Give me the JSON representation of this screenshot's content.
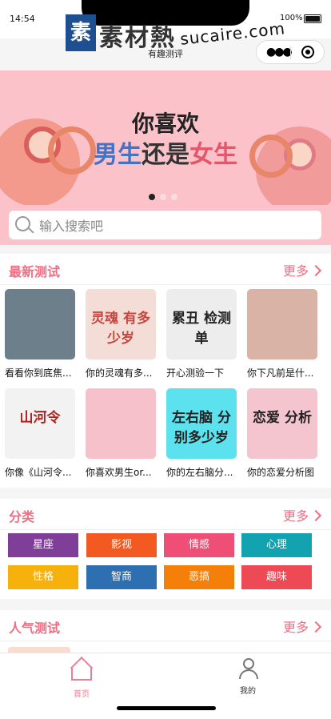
{
  "status": {
    "time": "14:54",
    "battery": "100%",
    "battery_level": 1.0
  },
  "watermark": {
    "cn": "素材熱",
    "mark": "素",
    "en": "sucaire.com"
  },
  "app": {
    "title": "有趣测评"
  },
  "banner": {
    "line1": "你喜欢",
    "line2_male": "男生",
    "line2_mid": "还是",
    "line2_female": "女生",
    "active_index": 0,
    "count": 3
  },
  "search": {
    "placeholder": "输入搜索吧"
  },
  "latest": {
    "title": "最新测试",
    "more": "更多",
    "items": [
      {
        "caption": "看看你到底焦...",
        "thumb_text": "",
        "thumb_color": "#6e7f8c"
      },
      {
        "caption": "你的灵魂有多...",
        "thumb_text": "灵魂 有多少岁",
        "thumb_color": "#f3ddd6"
      },
      {
        "caption": "开心测验一下",
        "thumb_text": "累丑 检测单",
        "thumb_color": "#ededed"
      },
      {
        "caption": "你下凡前是什...",
        "thumb_text": "",
        "thumb_color": "#d9b3a5"
      },
      {
        "caption": "你像《山河令...",
        "thumb_text": "山河令",
        "thumb_color": "#f2f2f2"
      },
      {
        "caption": "你喜欢男生or...",
        "thumb_text": "",
        "thumb_color": "#f6c1ca"
      },
      {
        "caption": "你的左右脑分...",
        "thumb_text": "左右脑 分别多少岁",
        "thumb_color": "#5ce2ee"
      },
      {
        "caption": "你的恋爱分析图",
        "thumb_text": "恋爱 分析",
        "thumb_color": "#f4c5ce"
      }
    ]
  },
  "category": {
    "title": "分类",
    "more": "更多",
    "items": [
      {
        "label": "星座",
        "color": "#7f3f98"
      },
      {
        "label": "影视",
        "color": "#f25a21"
      },
      {
        "label": "情感",
        "color": "#ef4f77"
      },
      {
        "label": "心理",
        "color": "#13a2b0"
      },
      {
        "label": "性格",
        "color": "#f7b10d"
      },
      {
        "label": "智商",
        "color": "#2d6fb0"
      },
      {
        "label": "恶搞",
        "color": "#f4800a"
      },
      {
        "label": "趣味",
        "color": "#ee4a56"
      }
    ]
  },
  "popular": {
    "title": "人气测试",
    "more": "更多"
  },
  "tabbar": {
    "home": "首页",
    "mine": "我的",
    "home_color": "#ee7d96"
  }
}
